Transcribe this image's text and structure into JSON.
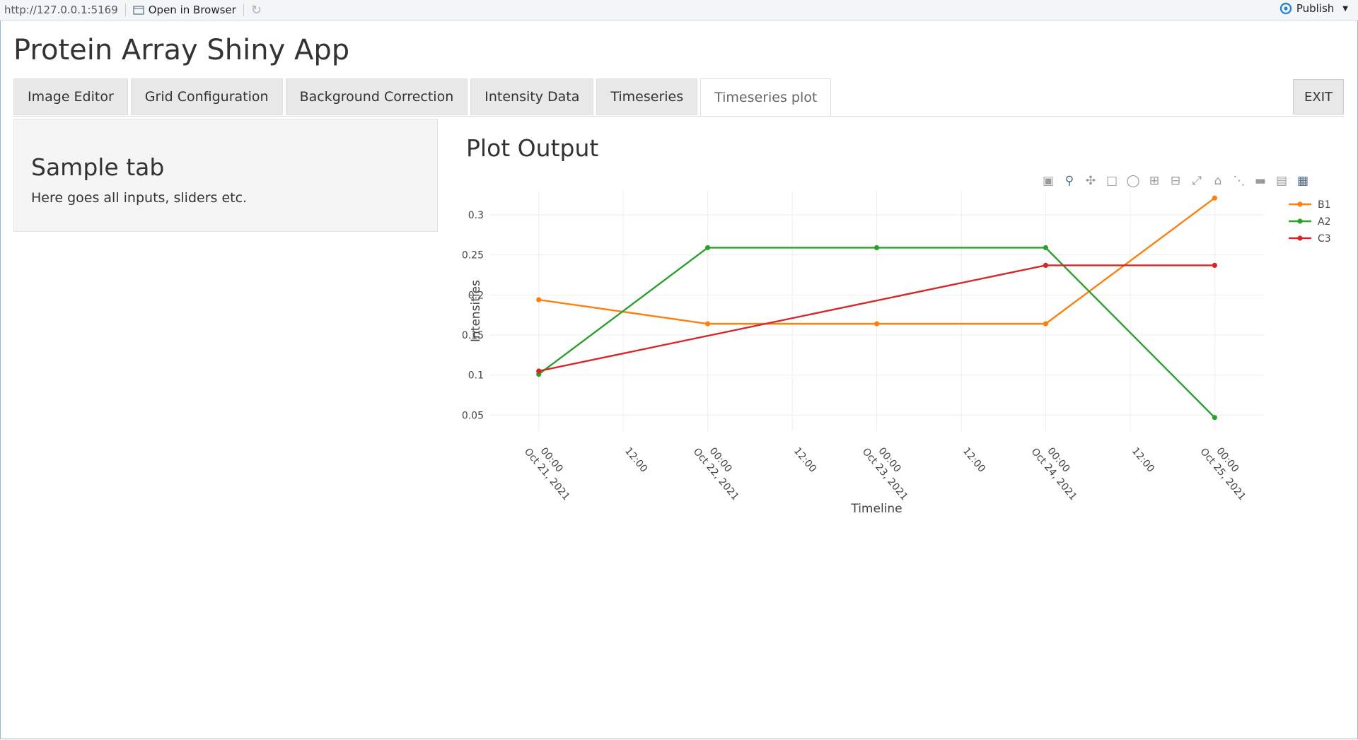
{
  "topbar": {
    "url": "http://127.0.0.1:5169",
    "open_browser_label": "Open in Browser",
    "publish_label": "Publish"
  },
  "app": {
    "title": "Protein Array Shiny App",
    "tabs": [
      {
        "label": "Image Editor"
      },
      {
        "label": "Grid Configuration"
      },
      {
        "label": "Background Correction"
      },
      {
        "label": "Intensity Data"
      },
      {
        "label": "Timeseries"
      },
      {
        "label": "Timeseries plot"
      }
    ],
    "active_tab": "Timeseries plot",
    "exit_label": "EXIT"
  },
  "sidebar": {
    "title": "Sample tab",
    "text": "Here goes all inputs, sliders etc."
  },
  "main": {
    "plot_title": "Plot Output"
  },
  "modebar": {
    "icons": [
      "camera-icon",
      "zoom-icon",
      "pan-icon",
      "box-select-icon",
      "lasso-icon",
      "zoom-in-icon",
      "zoom-out-icon",
      "autoscale-icon",
      "reset-axes-icon",
      "spike-lines-icon",
      "hover-closest-icon",
      "hover-compare-icon",
      "plotly-logo-icon"
    ]
  },
  "chart_data": {
    "type": "line",
    "x": [
      "2021-10-21 00:00",
      "2021-10-22 00:00",
      "2021-10-23 00:00",
      "2021-10-24 00:00",
      "2021-10-25 00:00"
    ],
    "x_ticks": [
      {
        "line1": "00:00",
        "line2": "Oct 21, 2021"
      },
      {
        "line1": "12:00",
        "line2": ""
      },
      {
        "line1": "00:00",
        "line2": "Oct 22, 2021"
      },
      {
        "line1": "12:00",
        "line2": ""
      },
      {
        "line1": "00:00",
        "line2": "Oct 23, 2021"
      },
      {
        "line1": "12:00",
        "line2": ""
      },
      {
        "line1": "00:00",
        "line2": "Oct 24, 2021"
      },
      {
        "line1": "12:00",
        "line2": ""
      },
      {
        "line1": "00:00",
        "line2": "Oct 25, 2021"
      }
    ],
    "y_ticks": [
      "0.05",
      "0.1",
      "0.15",
      "0.2",
      "0.25",
      "0.3"
    ],
    "ylim": [
      0.03,
      0.33
    ],
    "xlim": [
      "2021-10-20 17:00",
      "2021-10-25 07:00"
    ],
    "xlabel": "Timeline",
    "ylabel": "Intensities",
    "grid": true,
    "legend_position": "top-right",
    "series": [
      {
        "name": "B1",
        "color": "#ff7f0e",
        "values": [
          0.194,
          0.164,
          0.164,
          0.164,
          0.321
        ]
      },
      {
        "name": "A2",
        "color": "#2ca02c",
        "values": [
          0.101,
          0.259,
          0.259,
          0.259,
          0.047
        ]
      },
      {
        "name": "C3",
        "color": "#d62728",
        "values": [
          0.105,
          null,
          null,
          0.237,
          0.237
        ]
      }
    ]
  }
}
